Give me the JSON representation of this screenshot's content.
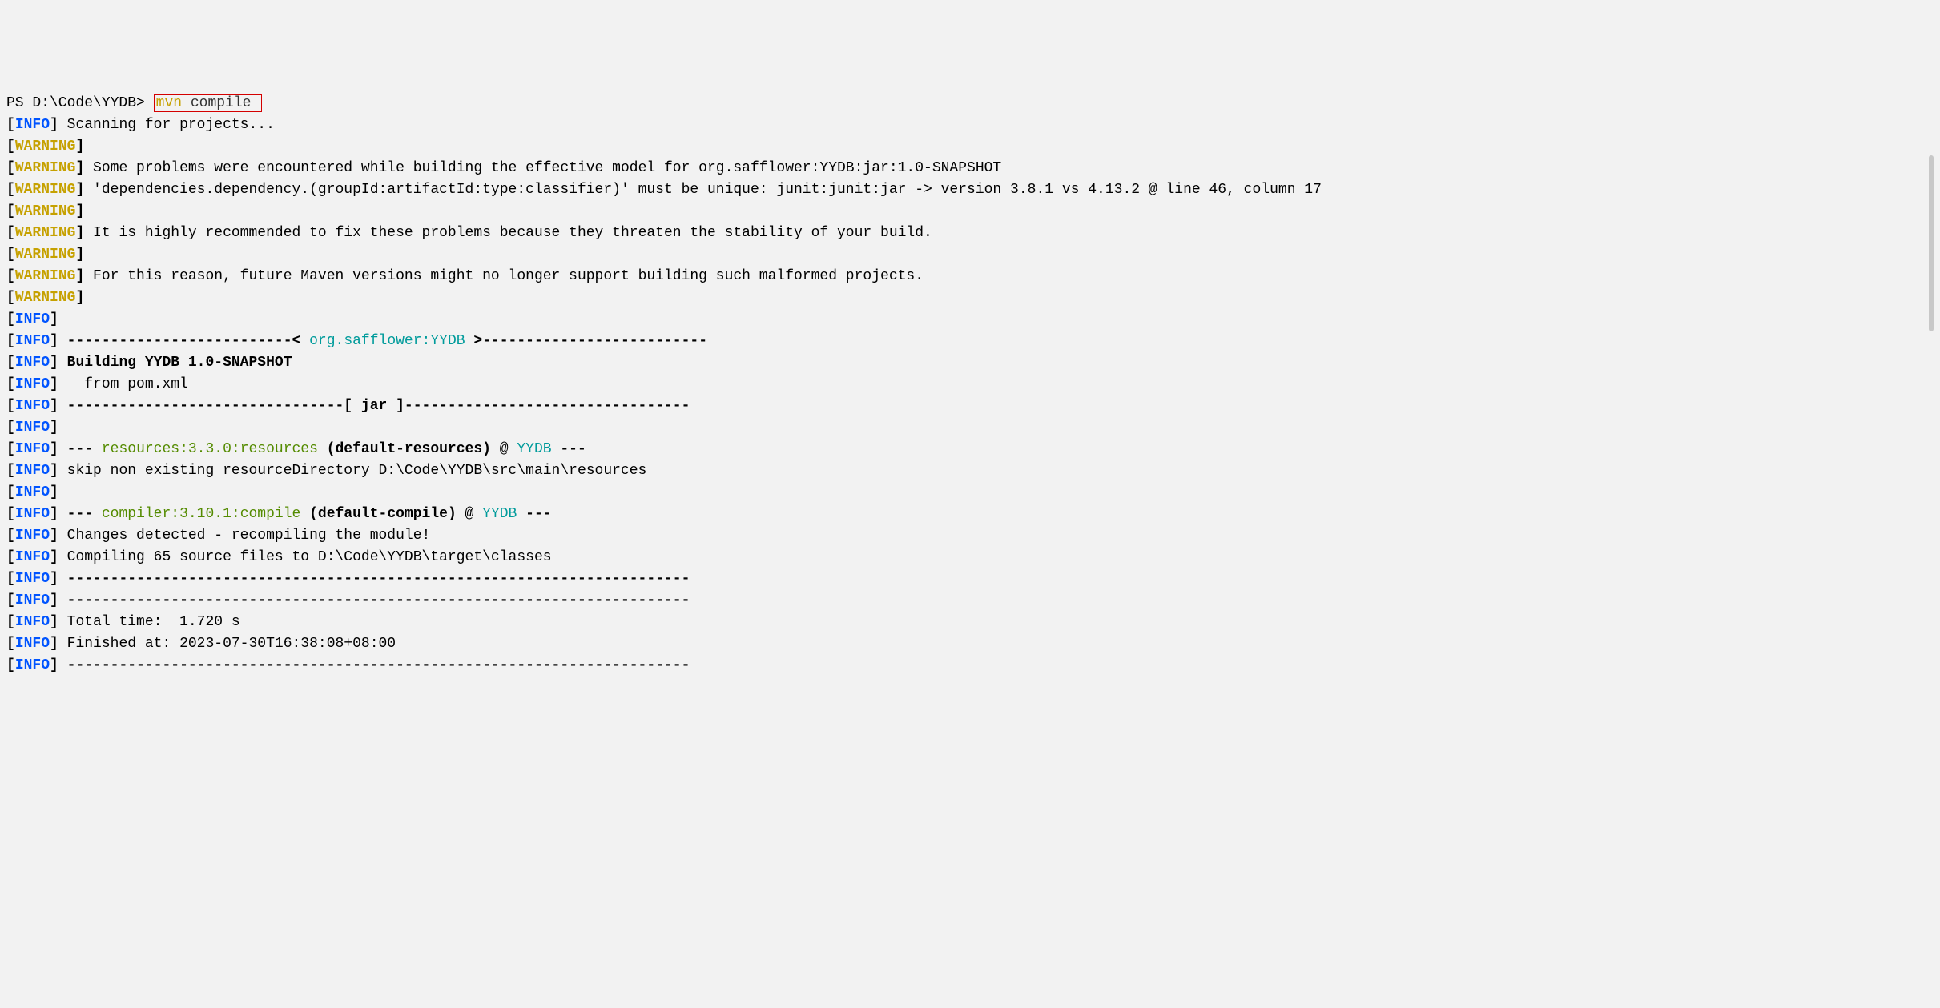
{
  "colors": {
    "background": "#f2f2f2",
    "info": "#0054ff",
    "warning": "#c6a100",
    "highlight_border": "#d40000",
    "cyan": "#009b9b",
    "green": "#548b00"
  },
  "tags": {
    "info": "INFO",
    "warning": "WARNING"
  },
  "prompt": "PS D:\\Code\\YYDB> ",
  "command": {
    "mvn": "mvn",
    "compile": " compile "
  },
  "lines": {
    "scanning": " Scanning for projects...",
    "warn_empty": " ",
    "warn_problems": " Some problems were encountered while building the effective model for org.safflower:YYDB:jar:1.0-SNAPSHOT",
    "warn_deps": " 'dependencies.dependency.(groupId:artifactId:type:classifier)' must be unique: junit:junit:jar -> version 3.8.1 vs 4.13.2 @ line 46, column 17",
    "warn_recommended": " It is highly recommended to fix these problems because they threaten the stability of your build.",
    "warn_future": " For this reason, future Maven versions might no longer support building such malformed projects.",
    "info_empty": "",
    "dashes_lt": " --------------------------< ",
    "project_coord": "org.safflower:YYDB",
    "dashes_gt": " >--------------------------",
    "building": " Building YYDB 1.0-SNAPSHOT",
    "from_pom": "   from pom.xml",
    "jar_line": " --------------------------------[ jar ]---------------------------------",
    "plugin_prefix": " --- ",
    "resources_plugin": "resources:3.3.0:resources",
    "default_resources": " (default-resources)",
    "at_symbol": " @ ",
    "yydb": "YYDB",
    "plugin_suffix": " ---",
    "skip_resources": " skip non existing resourceDirectory D:\\Code\\YYDB\\src\\main\\resources",
    "compiler_plugin": "compiler:3.10.1:compile",
    "default_compile": " (default-compile)",
    "changes_detected": " Changes detected - recompiling the module!",
    "compiling": " Compiling 65 source files to D:\\Code\\YYDB\\target\\classes",
    "long_dashes": " ------------------------------------------------------------------------",
    "total_time": " Total time:  1.720 s",
    "finished_at": " Finished at: 2023-07-30T16:38:08+08:00"
  }
}
